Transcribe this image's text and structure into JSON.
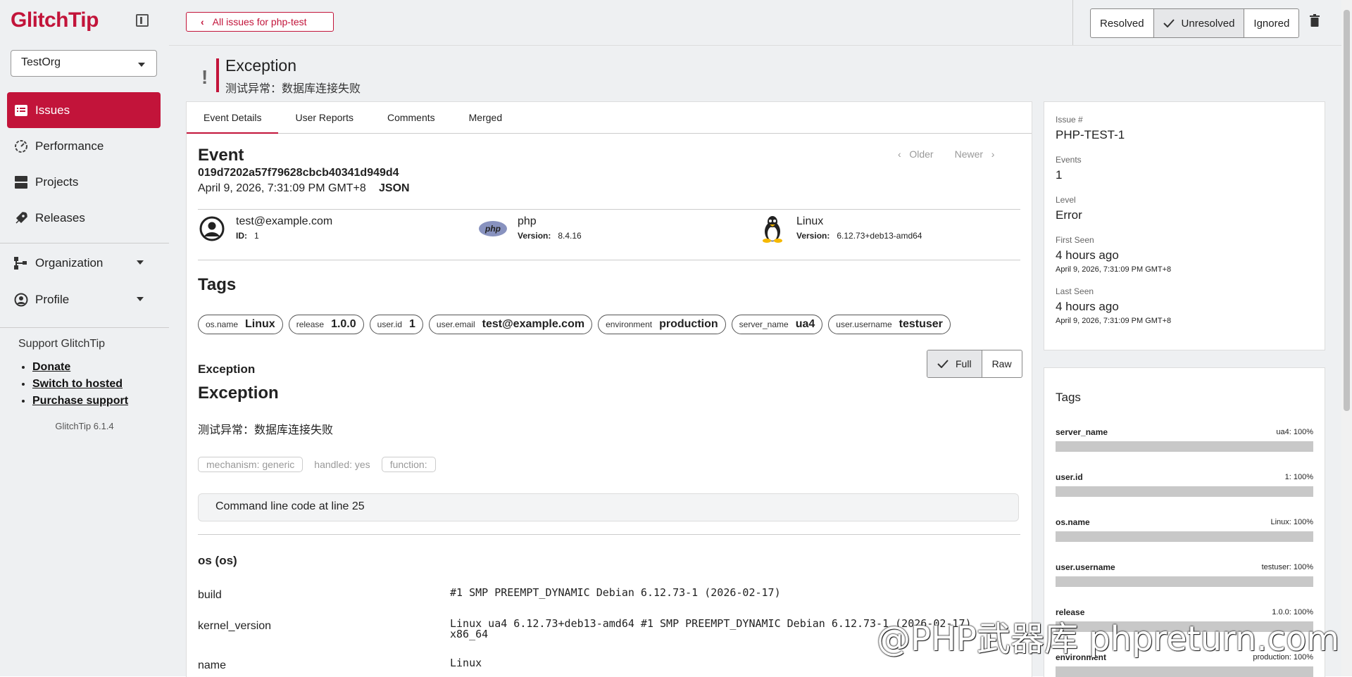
{
  "app": {
    "logo": "GlitchTip"
  },
  "sidebar": {
    "org": "TestOrg",
    "nav": [
      {
        "label": "Issues"
      },
      {
        "label": "Performance"
      },
      {
        "label": "Projects"
      },
      {
        "label": "Releases"
      },
      {
        "label": "Organization"
      },
      {
        "label": "Profile"
      }
    ],
    "support_title": "Support GlitchTip",
    "support_links": [
      "Donate",
      "Switch to hosted",
      "Purchase support"
    ],
    "version": "GlitchTip 6.1.4"
  },
  "topbar": {
    "back_label": "All issues for php-test",
    "status": {
      "resolved": "Resolved",
      "unresolved": "Unresolved",
      "ignored": "Ignored"
    }
  },
  "issue": {
    "title": "Exception",
    "subtitle": "测试异常：数据库连接失败"
  },
  "tabs": [
    "Event Details",
    "User Reports",
    "Comments",
    "Merged"
  ],
  "event": {
    "heading": "Event",
    "id": "019d7202a57f79628cbcb40341d949d4",
    "date": "April 9, 2026, 7:31:09 PM GMT+8",
    "json_label": "JSON",
    "older": "Older",
    "newer": "Newer",
    "user": {
      "email": "test@example.com",
      "id_label": "ID:",
      "id": "1"
    },
    "runtime": {
      "name": "php",
      "version_label": "Version:",
      "version": "8.4.16",
      "logo": "php"
    },
    "os": {
      "name": "Linux",
      "version_label": "Version:",
      "version": "6.12.73+deb13-amd64"
    }
  },
  "tags_heading": "Tags",
  "tags": [
    {
      "k": "os.name",
      "v": "Linux"
    },
    {
      "k": "release",
      "v": "1.0.0"
    },
    {
      "k": "user.id",
      "v": "1"
    },
    {
      "k": "user.email",
      "v": "test@example.com"
    },
    {
      "k": "environment",
      "v": "production"
    },
    {
      "k": "server_name",
      "v": "ua4"
    },
    {
      "k": "user.username",
      "v": "testuser"
    }
  ],
  "exception": {
    "section": "Exception",
    "heading": "Exception",
    "full": "Full",
    "raw": "Raw",
    "message": "测试异常：数据库连接失败",
    "mechanism": "mechanism: generic",
    "handled": "handled: yes",
    "function": "function:",
    "frame": "Command line code at line 25"
  },
  "os_context": {
    "heading": "os (os)",
    "rows": [
      {
        "k": "build",
        "v": "#1 SMP PREEMPT_DYNAMIC Debian 6.12.73-1 (2026-02-17)"
      },
      {
        "k": "kernel_version",
        "v": "Linux ua4 6.12.73+deb13-amd64 #1 SMP PREEMPT_DYNAMIC Debian 6.12.73-1 (2026-02-17)\nx86_64"
      },
      {
        "k": "name",
        "v": "Linux"
      }
    ]
  },
  "summary": {
    "issue_label": "Issue #",
    "issue": "PHP-TEST-1",
    "events_label": "Events",
    "events": "1",
    "level_label": "Level",
    "level": "Error",
    "first_label": "First Seen",
    "first_rel": "4 hours ago",
    "first_abs": "April 9, 2026, 7:31:09 PM GMT+8",
    "last_label": "Last Seen",
    "last_rel": "4 hours ago",
    "last_abs": "April 9, 2026, 7:31:09 PM GMT+8"
  },
  "tag_summary": {
    "heading": "Tags",
    "items": [
      {
        "name": "server_name",
        "pct_text": "ua4: 100%",
        "fraction": 1.0
      },
      {
        "name": "user.id",
        "pct_text": "1: 100%",
        "fraction": 1.0
      },
      {
        "name": "os.name",
        "pct_text": "Linux: 100%",
        "fraction": 1.0
      },
      {
        "name": "user.username",
        "pct_text": "testuser: 100%",
        "fraction": 1.0
      },
      {
        "name": "release",
        "pct_text": "1.0.0: 100%",
        "fraction": 1.0
      },
      {
        "name": "environment",
        "pct_text": "production: 100%",
        "fraction": 1.0
      }
    ]
  },
  "watermark": "@PHP武器库 phpreturn.com",
  "colors": {
    "accent": "#c2143a",
    "bg": "#eef0f2"
  }
}
